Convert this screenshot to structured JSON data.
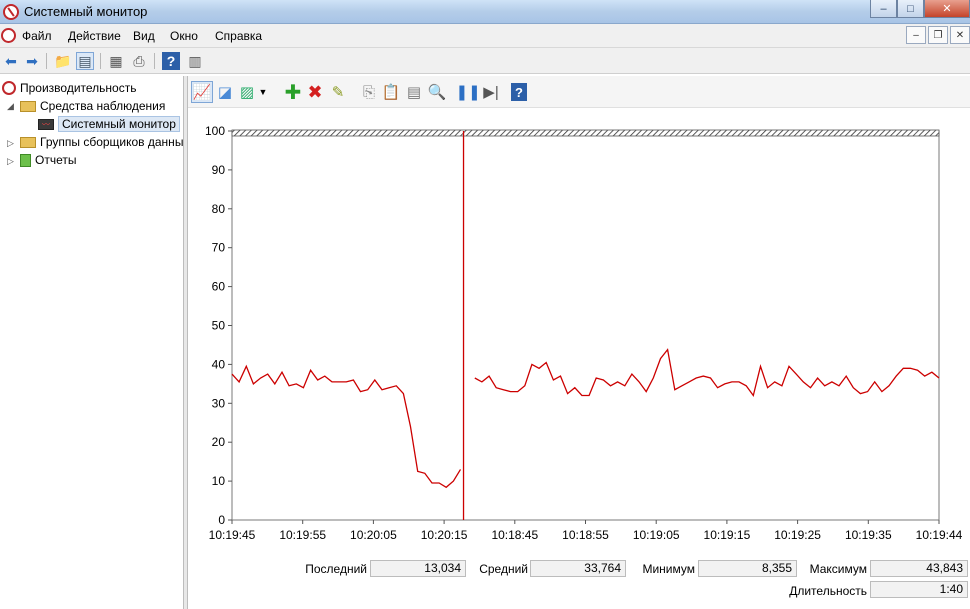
{
  "window": {
    "title": "Системный монитор",
    "minimize": "–",
    "maximize": "□",
    "close": "✕"
  },
  "menu": {
    "items": [
      "Файл",
      "Действие",
      "Вид",
      "Окно",
      "Справка"
    ],
    "mdi": {
      "minimize": "–",
      "restore": "❐",
      "close": "✕"
    }
  },
  "tree": {
    "items": [
      {
        "label": "Производительность",
        "icon": "performance-icon"
      },
      {
        "label": "Средства наблюдения",
        "icon": "folder-icon"
      },
      {
        "label": "Системный монитор",
        "icon": "monitor-icon",
        "selected": true
      },
      {
        "label": "Группы сборщиков данных",
        "icon": "collector-sets-icon"
      },
      {
        "label": "Отчеты",
        "icon": "reports-icon"
      }
    ]
  },
  "stats": {
    "last_label": "Последний",
    "last_value": "13,034",
    "avg_label": "Средний",
    "avg_value": "33,764",
    "min_label": "Минимум",
    "min_value": "8,355",
    "max_label": "Максимум",
    "max_value": "43,843",
    "duration_label": "Длительность",
    "duration_value": "1:40"
  },
  "colors": {
    "series": "#cc0000",
    "cursor": "#cc0000",
    "accent": "#c0282c"
  },
  "chart_data": {
    "type": "line",
    "title": "",
    "xlabel": "",
    "ylabel": "",
    "ylim": [
      0,
      100
    ],
    "yticks": [
      0,
      10,
      20,
      30,
      40,
      50,
      60,
      70,
      80,
      90,
      100
    ],
    "xtick_labels": [
      "10:19:45",
      "10:19:55",
      "10:20:05",
      "10:20:15",
      "10:18:45",
      "10:18:55",
      "10:19:05",
      "10:19:15",
      "10:19:25",
      "10:19:35",
      "10:19:44"
    ],
    "grid": false,
    "cursor_index": 32,
    "series": [
      {
        "values": [
          37.5,
          35.5,
          39.5,
          35,
          36.5,
          37.5,
          35,
          38,
          34.5,
          35,
          34,
          38.5,
          36,
          37,
          35.5,
          35.5,
          35.5,
          36,
          33,
          33.5,
          36,
          33.5,
          34,
          34.5,
          32.5,
          24,
          12.5,
          12,
          9.5,
          9.5,
          8.4,
          10,
          13,
          null,
          36.5,
          35.5,
          37,
          34,
          33.5,
          33,
          33,
          34.5,
          40,
          39,
          40.5,
          36,
          37,
          32.5,
          34,
          32,
          32,
          36.5,
          36,
          34.5,
          35.5,
          34.5,
          37.5,
          35.5,
          33,
          36.5,
          41.5,
          43.8,
          33.5,
          34.5,
          35.5,
          36.5,
          37,
          36.5,
          34,
          35,
          35.5,
          35.5,
          34.5,
          32,
          39.5,
          34,
          35.5,
          34.5,
          39.5,
          37.5,
          35.5,
          34,
          36.5,
          34.5,
          35.5,
          34.5,
          37,
          34,
          32.5,
          33,
          35.5,
          33,
          34.5,
          37,
          39,
          39,
          38.5,
          37,
          38,
          36.5
        ]
      }
    ]
  }
}
